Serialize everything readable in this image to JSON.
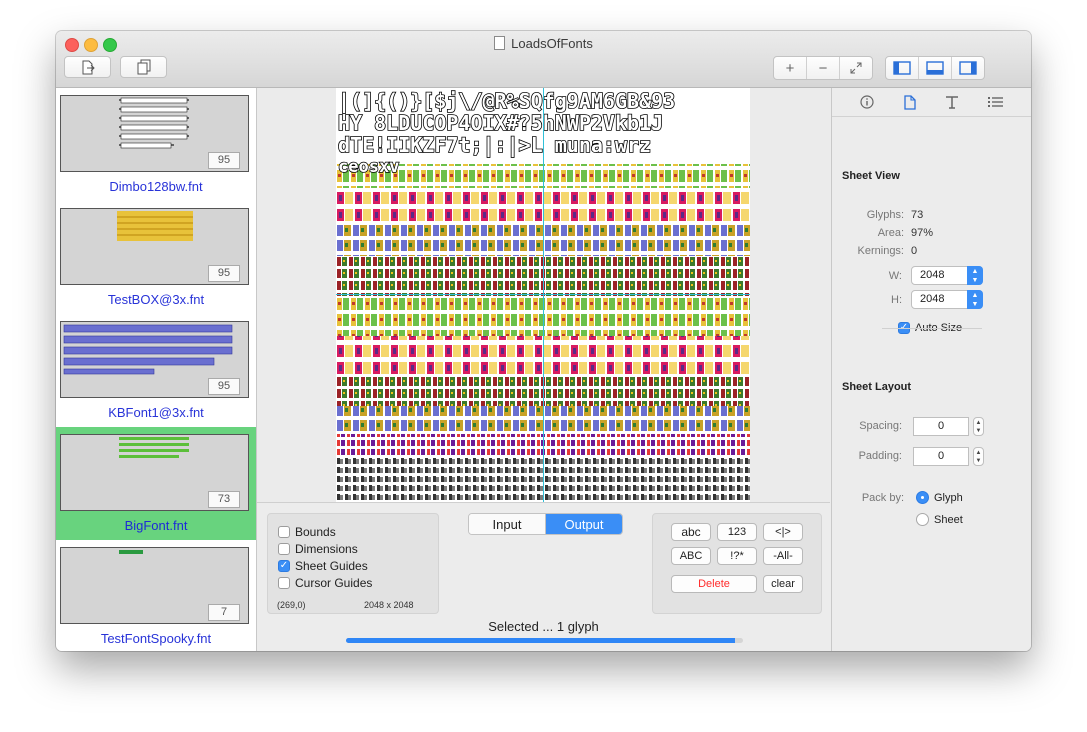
{
  "window": {
    "title": "LoadsOfFonts"
  },
  "toolbar": {
    "export_icon": "export-document-icon",
    "duplicate_icon": "duplicate-icon",
    "zoom_in_label": "+",
    "zoom_out_label": "−",
    "zoom_fit_icon": "expand-arrows-icon"
  },
  "sidebar": {
    "items": [
      {
        "name": "Dimbo128bw.fnt",
        "count": "95",
        "selected": false
      },
      {
        "name": "TestBOX@3x.fnt",
        "count": "95",
        "selected": false
      },
      {
        "name": "KBFont1@3x.fnt",
        "count": "95",
        "selected": false
      },
      {
        "name": "BigFont.fnt",
        "count": "73",
        "selected": true
      },
      {
        "name": "TestFontSpooky.fnt",
        "count": "7",
        "selected": false
      }
    ]
  },
  "preview": {
    "sample_lines": [
      "|(]{()}[$j\\/@R%SQfg9AM6GB&93",
      "HY 8LDUCOP4OIX#?5hNWP2Vkb1J",
      "dTE!IIKZF7t;|:|>L muna:wrz",
      "ceosxv"
    ]
  },
  "options": {
    "checkboxes": [
      {
        "label": "Bounds",
        "checked": false
      },
      {
        "label": "Dimensions",
        "checked": false
      },
      {
        "label": "Sheet Guides",
        "checked": true
      },
      {
        "label": "Cursor Guides",
        "checked": false
      }
    ],
    "coords": "(269,0)",
    "dimensions": "2048 x 2048"
  },
  "mode": {
    "input_label": "Input",
    "output_label": "Output",
    "selected": "Output"
  },
  "filter_buttons": {
    "lowercase": "abc",
    "digits": "123",
    "brackets": "<|>",
    "uppercase": "ABC",
    "punctuation": "!?*",
    "all": "-All-",
    "delete": "Delete",
    "clear": "clear"
  },
  "status": {
    "text": "Selected ... 1 glyph",
    "progress": 0.98
  },
  "inspector": {
    "tabs": [
      "info-icon",
      "document-icon",
      "text-format-icon",
      "list-icon"
    ],
    "sheet_view": {
      "title": "Sheet View",
      "glyphs_label": "Glyphs:",
      "glyphs": "73",
      "area_label": "Area:",
      "area": "97%",
      "kernings_label": "Kernings:",
      "kernings": "0",
      "w_label": "W:",
      "w": "2048",
      "h_label": "H:",
      "h": "2048",
      "auto_size_label": "Auto Size",
      "auto_size": true
    },
    "sheet_layout": {
      "title": "Sheet Layout",
      "spacing_label": "Spacing:",
      "spacing": "0",
      "padding_label": "Padding:",
      "padding": "0",
      "pack_by_label": "Pack by:",
      "pack_options": [
        "Glyph",
        "Sheet"
      ],
      "pack_selected": "Glyph"
    }
  },
  "colors": {
    "selection_green": "#68d37e",
    "accent_blue": "#3a8ef6",
    "link_blue": "#2833d8",
    "delete_red": "#ff2b2b"
  }
}
